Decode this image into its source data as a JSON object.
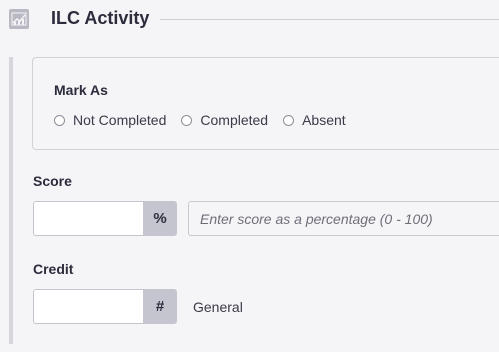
{
  "header": {
    "title": "ILC Activity",
    "icon": "chart-icon"
  },
  "mark_as": {
    "title": "Mark As",
    "options": [
      {
        "label": "Not Completed",
        "selected": false
      },
      {
        "label": "Completed",
        "selected": false
      },
      {
        "label": "Absent",
        "selected": false
      }
    ]
  },
  "score": {
    "label": "Score",
    "value": "",
    "unit": "%",
    "hint": "Enter score as a percentage (0 - 100)"
  },
  "credit": {
    "label": "Credit",
    "value": "",
    "unit": "#",
    "type": "General"
  },
  "colors": {
    "background": "#f5f5f7",
    "addon": "#c5c5cf",
    "text": "#2c2c3c"
  }
}
